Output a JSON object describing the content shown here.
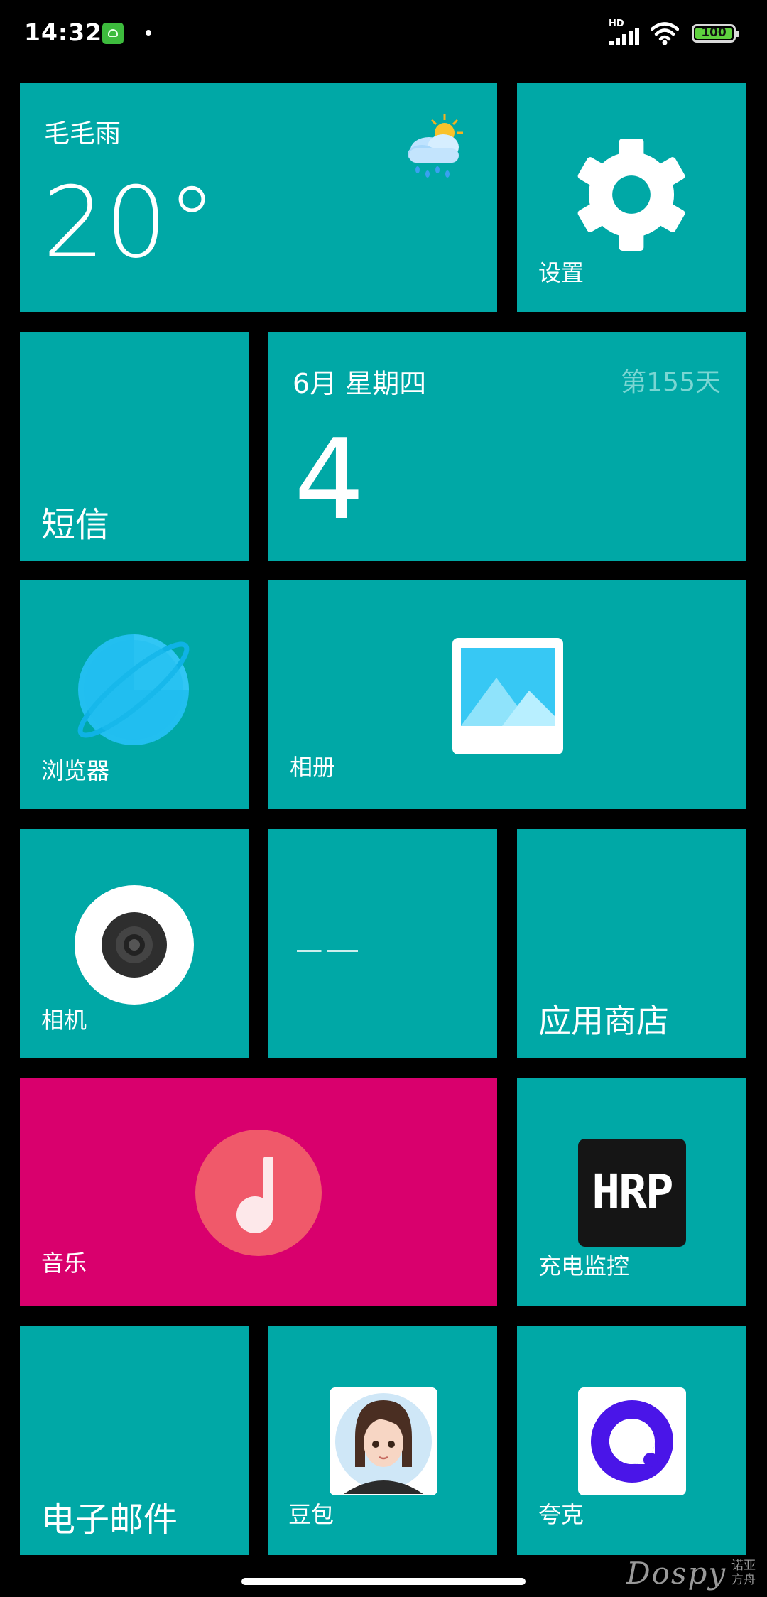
{
  "status_bar": {
    "time": "14:32",
    "network": "HD",
    "battery": "100",
    "battery_level": 1.0
  },
  "tiles": {
    "weather": {
      "condition": "毛毛雨",
      "temperature": "20°",
      "icon": "cloud-rain-sun-icon"
    },
    "settings": {
      "label": "设置",
      "icon": "gear-icon"
    },
    "sms": {
      "label": "短信"
    },
    "calendar": {
      "month_weekday": "6月 星期四",
      "day_count": "第155天",
      "date": "4"
    },
    "browser": {
      "label": "浏览器",
      "icon": "planet-icon"
    },
    "gallery": {
      "label": "相册",
      "icon": "photo-icon"
    },
    "camera": {
      "label": "相机",
      "icon": "camera-lens-icon"
    },
    "appstore": {
      "label": "应用商店"
    },
    "music": {
      "label": "音乐",
      "icon": "music-note-icon"
    },
    "charge_monitor": {
      "label": "充电监控",
      "icon_text": "HRP"
    },
    "email": {
      "label": "电子邮件"
    },
    "doubao": {
      "label": "豆包",
      "icon": "avatar-girl-icon"
    },
    "quark": {
      "label": "夸克",
      "icon": "quark-icon"
    }
  },
  "watermark": {
    "brand": "Dospy",
    "line1": "诺亚",
    "line2": "方舟"
  },
  "colors": {
    "tile": "#00a8a6",
    "music_tile": "#d9006d",
    "background": "#000000"
  }
}
